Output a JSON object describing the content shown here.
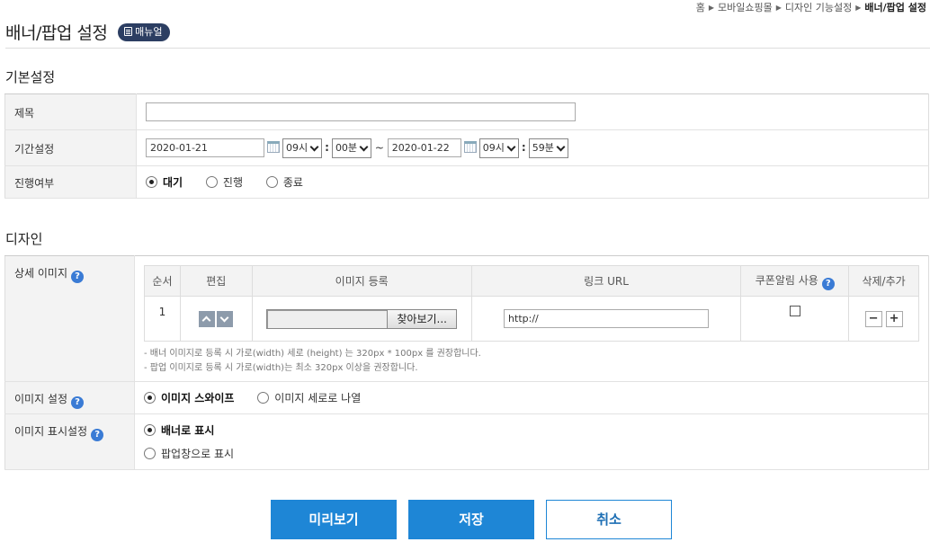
{
  "breadcrumb": {
    "items": [
      "홈",
      "모바일쇼핑몰",
      "디자인 기능설정"
    ],
    "current": "배너/팝업 설정"
  },
  "page": {
    "title": "배너/팝업 설정",
    "manual_label": "매뉴얼"
  },
  "basic": {
    "section_title": "기본설정",
    "title_label": "제목",
    "title_value": "",
    "period_label": "기간설정",
    "start_date": "2020-01-21",
    "start_hour": "09시",
    "start_min": "00분",
    "tilde": "~",
    "end_date": "2020-01-22",
    "end_hour": "09시",
    "end_min": "59분",
    "status_label": "진행여부",
    "status_options": [
      "대기",
      "진행",
      "종료"
    ],
    "status_selected": "대기"
  },
  "design": {
    "section_title": "디자인",
    "detail_image_label": "상세 이미지",
    "columns": [
      "순서",
      "편집",
      "이미지 등록",
      "링크 URL",
      "쿠폰알림 사용",
      "삭제/추가"
    ],
    "rows": [
      {
        "order": "1",
        "browse_label": "찾아보기...",
        "link_url": "http://",
        "coupon_checked": false
      }
    ],
    "notes": [
      "- 배너 이미지로 등록 시 가로(width) 세로 (height) 는 320px * 100px 를 권장합니다.",
      "- 팝업 이미지로 등록 시 가로(width)는 최소 320px 이상을 권장합니다."
    ],
    "image_setting_label": "이미지 설정",
    "image_setting_options": [
      "이미지 스와이프",
      "이미지 세로로 나열"
    ],
    "image_setting_selected": "이미지 스와이프",
    "display_setting_label": "이미지 표시설정",
    "display_options": [
      "배너로 표시",
      "팝업창으로 표시"
    ],
    "display_selected": "배너로 표시",
    "minus_label": "−",
    "plus_label": "+"
  },
  "actions": {
    "preview": "미리보기",
    "save": "저장",
    "cancel": "취소"
  },
  "colors": {
    "primary": "#1e86d6",
    "badge": "#2c3e62",
    "help": "#3a7bd5"
  }
}
